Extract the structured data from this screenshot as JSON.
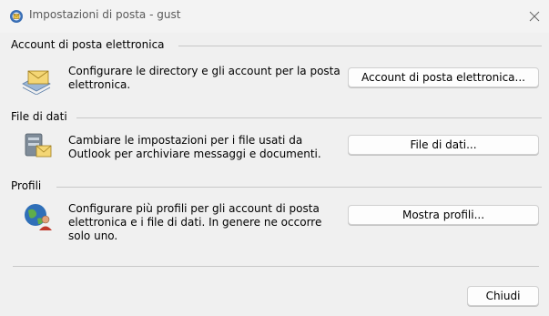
{
  "window": {
    "title": "Impostazioni di posta - gust",
    "close_glyph": "✕"
  },
  "sections": [
    {
      "heading": "Account di posta elettronica",
      "description": "Configurare le directory e gli account per la posta elettronica.",
      "button_label": "Account di posta elettronica...",
      "icon": "email-accounts-icon"
    },
    {
      "heading": "File di dati",
      "description": "Cambiare le impostazioni per i file usati da Outlook per archiviare messaggi e documenti.",
      "button_label": "File di dati...",
      "icon": "data-files-icon"
    },
    {
      "heading": "Profili",
      "description": "Configurare più profili per gli account di posta elettronica e i file di dati. In genere ne occorre solo uno.",
      "button_label": "Mostra profili...",
      "icon": "profiles-icon"
    }
  ],
  "footer": {
    "close_button_label": "Chiudi"
  },
  "colors": {
    "background": "#f0f0f0",
    "button_bg": "#fdfdfd",
    "border": "#d0d0d0"
  }
}
